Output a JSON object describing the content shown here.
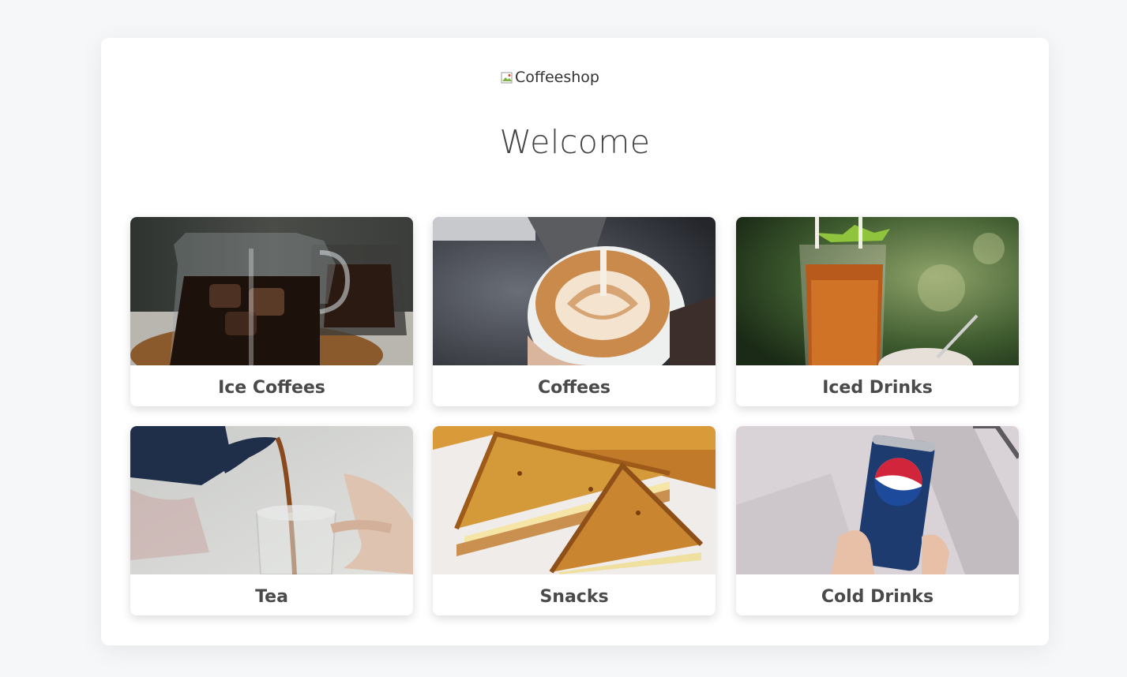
{
  "header": {
    "logo_alt": "Coffeeshop",
    "welcome": "Welcome"
  },
  "categories": [
    {
      "label": "Ice Coffees",
      "image": "iced-coffee-pitcher-photo"
    },
    {
      "label": "Coffees",
      "image": "latte-art-photo"
    },
    {
      "label": "Iced Drinks",
      "image": "iced-tea-glass-photo"
    },
    {
      "label": "Tea",
      "image": "tea-pouring-photo"
    },
    {
      "label": "Snacks",
      "image": "toasted-sandwich-photo"
    },
    {
      "label": "Cold Drinks",
      "image": "pepsi-can-photo"
    }
  ],
  "colors": {
    "page_bg": "#f5f7f9",
    "card_bg": "#ffffff",
    "label_text": "#4a4a4a",
    "heading_text": "#444444"
  }
}
